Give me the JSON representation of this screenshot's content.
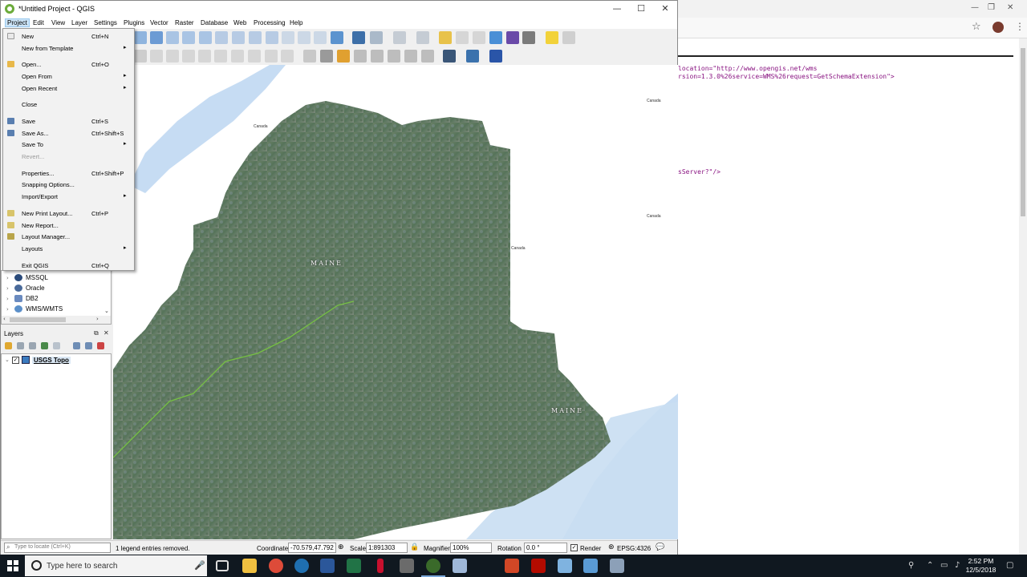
{
  "qgis": {
    "title": "*Untitled Project - QGIS",
    "menubar": [
      "Project",
      "Edit",
      "View",
      "Layer",
      "Settings",
      "Plugins",
      "Vector",
      "Raster",
      "Database",
      "Web",
      "Processing",
      "Help"
    ]
  },
  "project_menu": {
    "items": [
      {
        "label": "New",
        "shortcut": "Ctrl+N",
        "icon": "new-project-icon"
      },
      {
        "label": "New from Template",
        "submenu": true
      },
      {
        "label": "Open...",
        "shortcut": "Ctrl+O",
        "icon": "open-folder-icon"
      },
      {
        "label": "Open From",
        "submenu": true
      },
      {
        "label": "Open Recent",
        "submenu": true
      },
      {
        "label": "Close"
      },
      {
        "label": "Save",
        "shortcut": "Ctrl+S",
        "icon": "save-icon"
      },
      {
        "label": "Save As...",
        "shortcut": "Ctrl+Shift+S",
        "icon": "save-as-icon"
      },
      {
        "label": "Save To",
        "submenu": true
      },
      {
        "label": "Revert...",
        "disabled": true
      },
      {
        "label": "Properties...",
        "shortcut": "Ctrl+Shift+P"
      },
      {
        "label": "Snapping Options..."
      },
      {
        "label": "Import/Export",
        "submenu": true
      },
      {
        "label": "New Print Layout...",
        "shortcut": "Ctrl+P",
        "icon": "print-layout-icon"
      },
      {
        "label": "New Report...",
        "icon": "report-icon"
      },
      {
        "label": "Layout Manager...",
        "icon": "layout-manager-icon"
      },
      {
        "label": "Layouts",
        "submenu": true
      },
      {
        "label": "Exit QGIS",
        "shortcut": "Ctrl+Q"
      }
    ]
  },
  "browser": {
    "items": [
      "MSSQL",
      "Oracle",
      "DB2",
      "WMS/WMTS"
    ]
  },
  "layers": {
    "title": "Layers",
    "layer_name": "USGS Topo",
    "checked": true
  },
  "map": {
    "labels": [
      "MAINE",
      "MAINE"
    ],
    "small_labels": [
      "Canada",
      "Canada",
      "Canada",
      "Canada"
    ]
  },
  "status": {
    "locate_placeholder": "Type to locate (Ctrl+K)",
    "message": "1 legend entries removed.",
    "coordinate_label": "Coordinate",
    "coordinate": "-70.579,47.792",
    "scale_label": "Scale",
    "scale": "1:891303",
    "magnifier_label": "Magnifier",
    "magnifier": "100%",
    "rotation_label": "Rotation",
    "rotation": "0.0 °",
    "render_label": "Render",
    "crs": "EPSG:4326"
  },
  "browser_window": {
    "xml_lines": [
      "location=\"http://www.opengis.net/wms",
      "rsion=1.3.0%26service=WMS%26request=GetSchemaExtension\">",
      "sServer?\"/>"
    ]
  },
  "taskbar": {
    "search_placeholder": "Type here to search",
    "time": "2:52 PM",
    "date": "12/5/2018"
  },
  "colors": {
    "menu_highlight": "#cce4f7",
    "water": "#c6dcf3",
    "land": "#5f7b63",
    "taskbar": "#101820"
  }
}
